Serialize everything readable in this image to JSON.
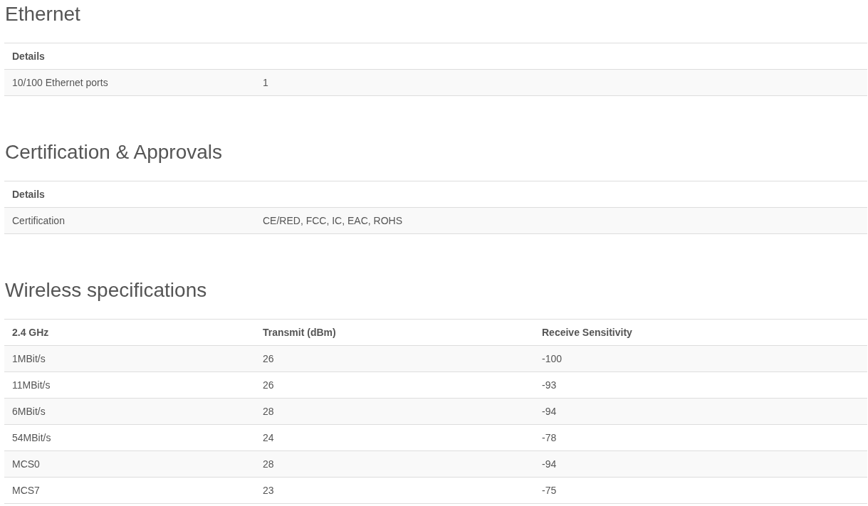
{
  "sections": [
    {
      "title": "Ethernet",
      "table": {
        "columns": [
          "Details"
        ],
        "rows": [
          [
            "10/100 Ethernet ports",
            "1"
          ]
        ]
      }
    },
    {
      "title": "Certification & Approvals",
      "table": {
        "columns": [
          "Details"
        ],
        "rows": [
          [
            "Certification",
            "CE/RED, FCC, IC, EAC, ROHS"
          ]
        ]
      }
    },
    {
      "title": "Wireless specifications",
      "table": {
        "columns": [
          "2.4 GHz",
          "Transmit (dBm)",
          "Receive Sensitivity"
        ],
        "rows": [
          [
            "1MBit/s",
            "26",
            "-100"
          ],
          [
            "11MBit/s",
            "26",
            "-93"
          ],
          [
            "6MBit/s",
            "28",
            "-94"
          ],
          [
            "54MBit/s",
            "24",
            "-78"
          ],
          [
            "MCS0",
            "28",
            "-94"
          ],
          [
            "MCS7",
            "23",
            "-75"
          ]
        ]
      }
    }
  ]
}
